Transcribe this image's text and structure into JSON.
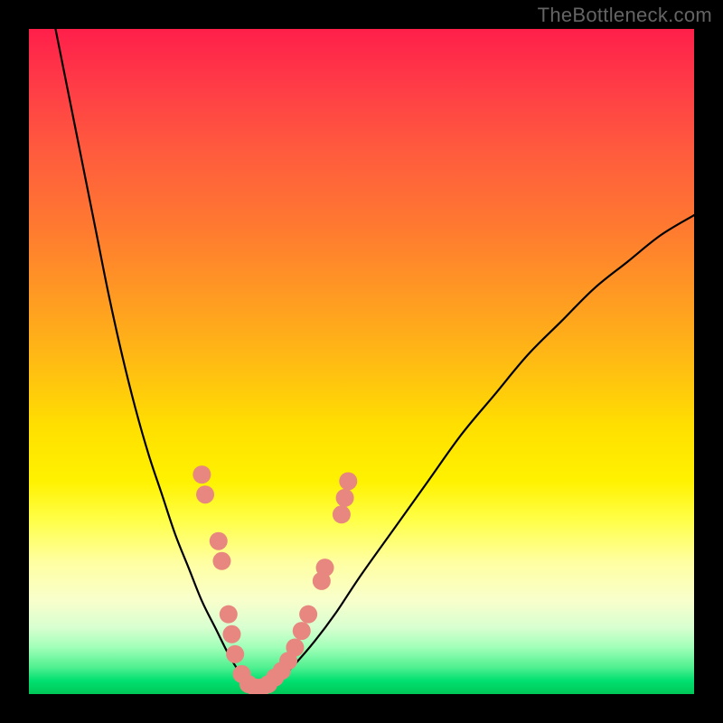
{
  "watermark": "TheBottleneck.com",
  "chart_data": {
    "type": "line",
    "title": "",
    "xlabel": "",
    "ylabel": "",
    "xlim": [
      0,
      100
    ],
    "ylim": [
      0,
      100
    ],
    "grid": false,
    "legend": false,
    "gradient_colors_top_to_bottom": [
      "#ff1f4a",
      "#ff5a3e",
      "#ff9a25",
      "#ffd60a",
      "#fff200",
      "#ffff70",
      "#f0ffc0",
      "#90f5a0",
      "#00d868"
    ],
    "series": [
      {
        "name": "left-curve",
        "stroke": "#000000",
        "x": [
          4,
          6,
          8,
          10,
          12,
          14,
          16,
          18,
          20,
          22,
          24,
          26,
          28,
          30,
          31.5,
          33,
          34.5
        ],
        "y": [
          100,
          90,
          80,
          70,
          60,
          51,
          43,
          36,
          30,
          24,
          19,
          14,
          10,
          6,
          3.5,
          1.5,
          0.5
        ]
      },
      {
        "name": "right-curve",
        "stroke": "#000000",
        "x": [
          35,
          36,
          38,
          40,
          43,
          46,
          50,
          55,
          60,
          65,
          70,
          75,
          80,
          85,
          90,
          95,
          100
        ],
        "y": [
          0.5,
          1,
          2.5,
          4.5,
          8,
          12,
          18,
          25,
          32,
          39,
          45,
          51,
          56,
          61,
          65,
          69,
          72
        ]
      }
    ],
    "scatter_overlay": {
      "marker_color": "#e8877f",
      "marker_radius": 10,
      "points": [
        {
          "x": 26,
          "y": 33
        },
        {
          "x": 26.5,
          "y": 30
        },
        {
          "x": 28.5,
          "y": 23
        },
        {
          "x": 29,
          "y": 20
        },
        {
          "x": 30,
          "y": 12
        },
        {
          "x": 30.5,
          "y": 9
        },
        {
          "x": 31,
          "y": 6
        },
        {
          "x": 32,
          "y": 3
        },
        {
          "x": 33,
          "y": 1.5
        },
        {
          "x": 34,
          "y": 1
        },
        {
          "x": 35,
          "y": 1
        },
        {
          "x": 36,
          "y": 1.5
        },
        {
          "x": 37,
          "y": 2.5
        },
        {
          "x": 38,
          "y": 3.5
        },
        {
          "x": 39,
          "y": 5
        },
        {
          "x": 40,
          "y": 7
        },
        {
          "x": 41,
          "y": 9.5
        },
        {
          "x": 42,
          "y": 12
        },
        {
          "x": 44,
          "y": 17
        },
        {
          "x": 44.5,
          "y": 19
        },
        {
          "x": 47,
          "y": 27
        },
        {
          "x": 47.5,
          "y": 29.5
        },
        {
          "x": 48,
          "y": 32
        }
      ]
    }
  }
}
